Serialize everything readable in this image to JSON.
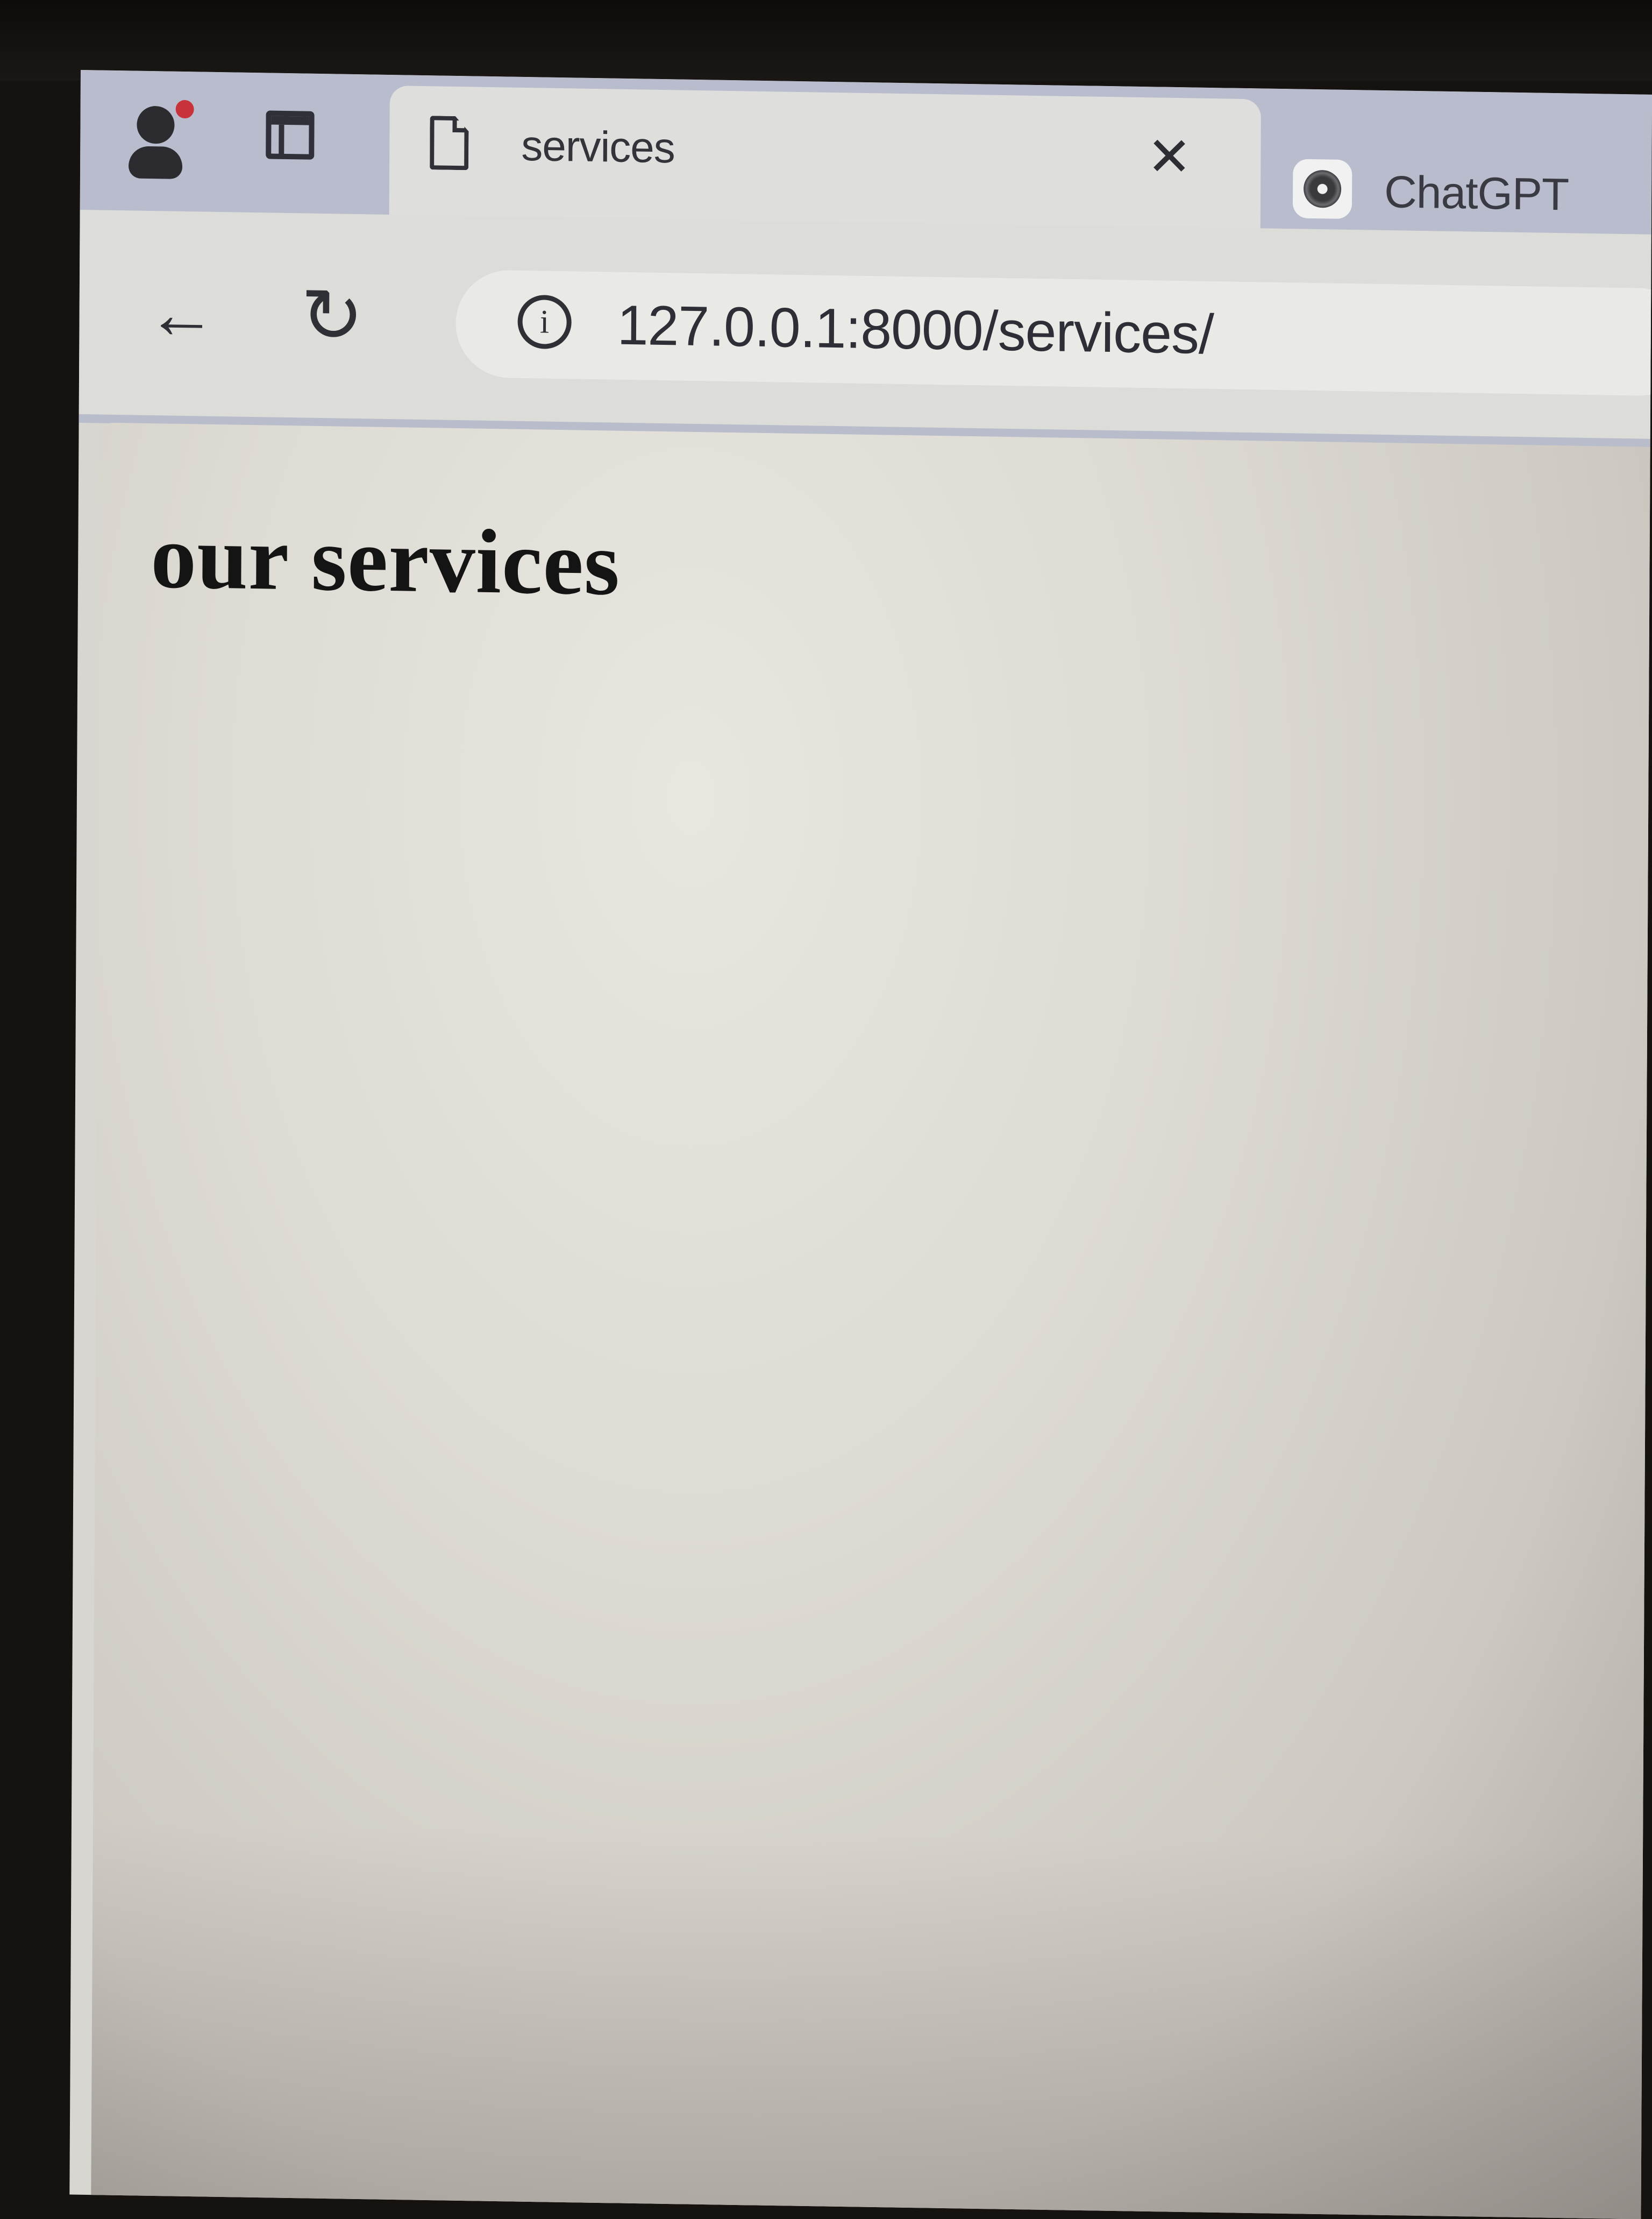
{
  "tabs": [
    {
      "title": "services",
      "active": true,
      "icon": "page-icon"
    },
    {
      "title": "ChatGPT",
      "active": false,
      "icon": "chatgpt-icon"
    }
  ],
  "tab_close_glyph": "✕",
  "toolbar": {
    "back_glyph": "←",
    "reload_glyph": "↻",
    "info_glyph": "i",
    "url": "127.0.0.1:8000/services/"
  },
  "page": {
    "heading": "our services"
  },
  "colors": {
    "tab_strip": "#b9bccd",
    "active_tab": "#dedfdc",
    "page_background": "#e6e4dd",
    "heading_text": "#141414"
  }
}
